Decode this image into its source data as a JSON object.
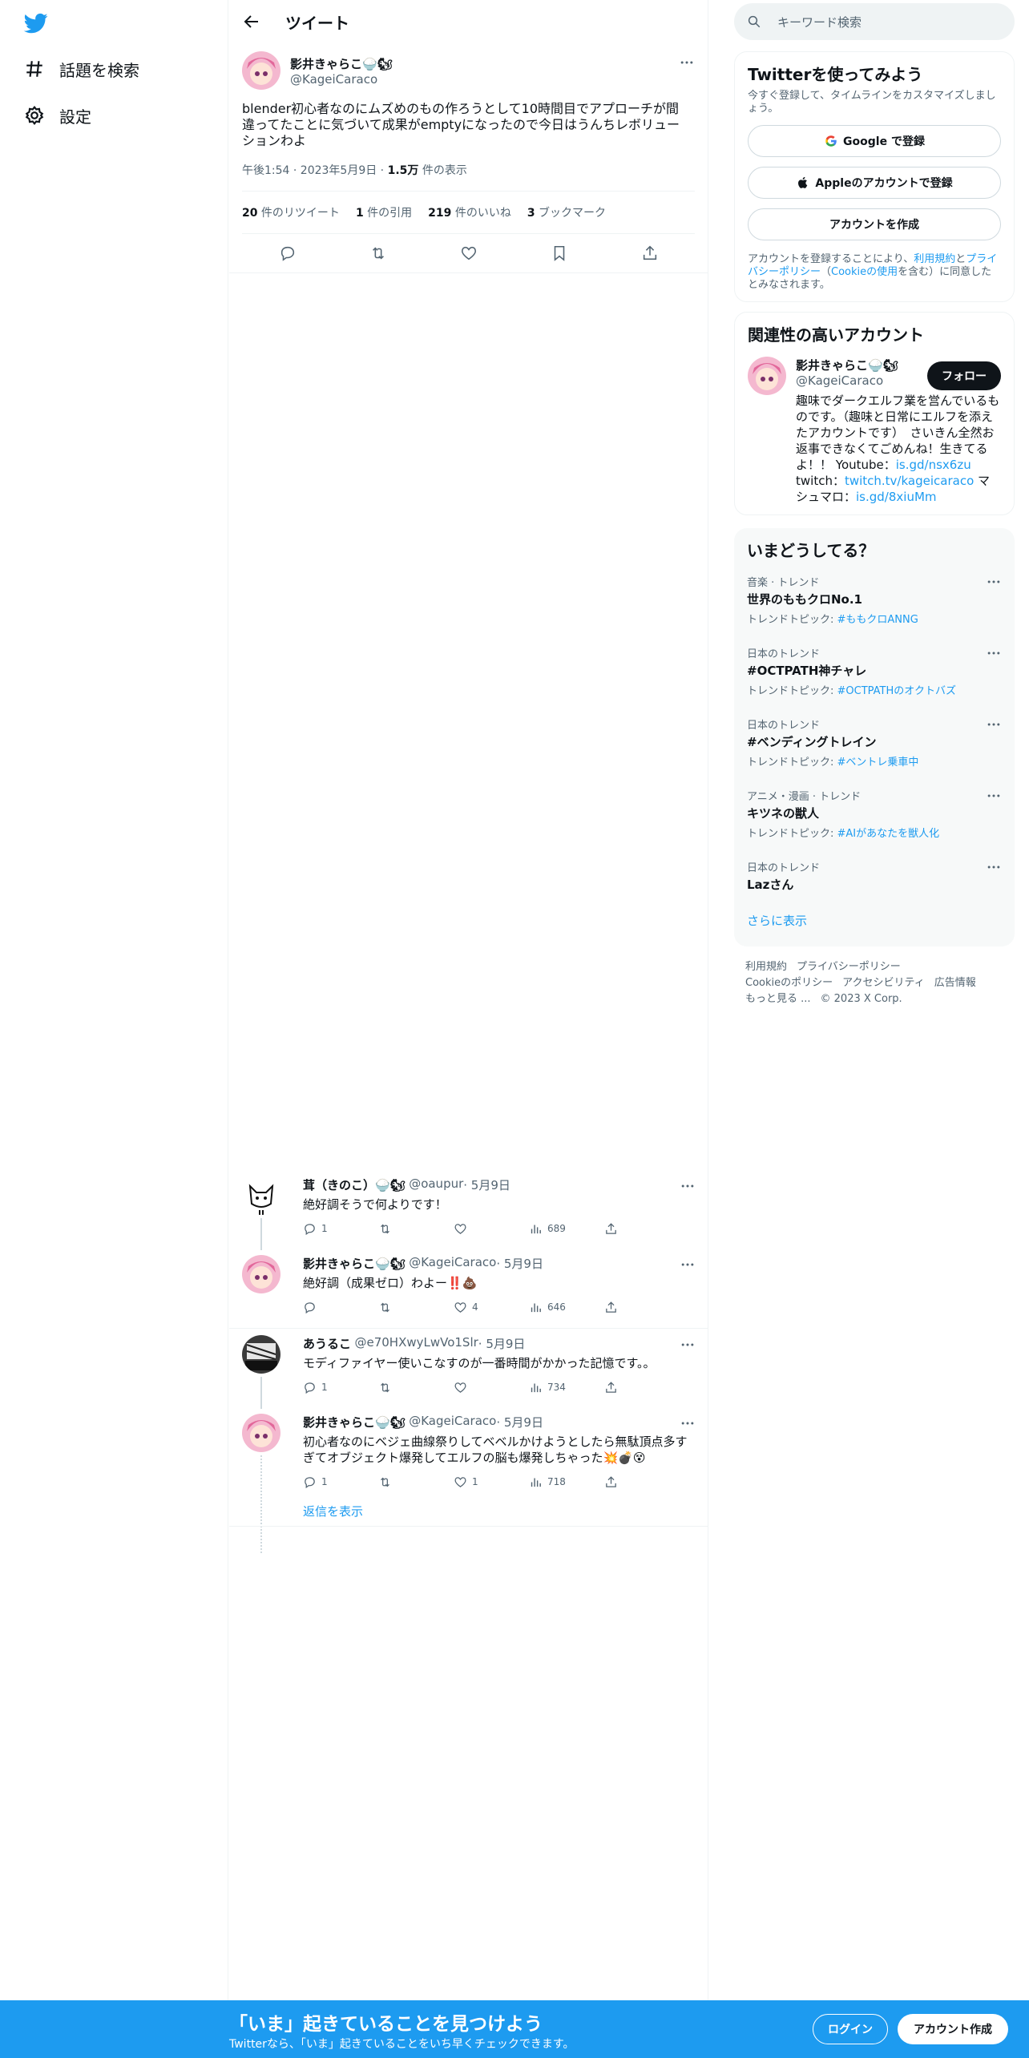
{
  "nav": {
    "explore_label": "話題を検索",
    "settings_label": "設定"
  },
  "header": {
    "title": "ツイート"
  },
  "tweet": {
    "name": "影井きゃらこ🍚🐿",
    "handle": "@KageiCaraco",
    "text": "blender初心者なのにムズめのもの作ろうとして10時間目でアプローチが間違ってたことに気づいて成果がemptyになったので今日はうんちレボリューションわよ",
    "time": "午後1:54 · 2023年5月9日 · ",
    "views_count": "1.5万",
    "views_label": " 件の表示",
    "stats": {
      "retweets_count": "20",
      "retweets_label": " 件のリツイート",
      "quotes_count": "1",
      "quotes_label": " 件の引用",
      "likes_count": "219",
      "likes_label": " 件のいいね",
      "bookmarks_count": "3",
      "bookmarks_label": " ブックマーク"
    }
  },
  "replies": [
    {
      "name": "茸（きのこ）🍚🐿",
      "handle": "@oaupur",
      "date": " · 5月9日",
      "text": "絶好調そうで何よりです！",
      "reply_count": "1",
      "retweet_count": "",
      "like_count": "",
      "view_count": "689"
    },
    {
      "name": "影井きゃらこ🍚🐿",
      "handle": "@KageiCaraco",
      "date": " · 5月9日",
      "text": "絶好調（成果ゼロ）わよー‼️💩",
      "reply_count": "",
      "retweet_count": "",
      "like_count": "4",
      "view_count": "646"
    },
    {
      "name": "あうるこ",
      "handle": "@e70HXwyLwVo1Slr",
      "date": " · 5月9日",
      "text": "モディファイヤー使いこなすのが一番時間がかかった記憶です。。",
      "reply_count": "1",
      "retweet_count": "",
      "like_count": "",
      "view_count": "734"
    },
    {
      "name": "影井きゃらこ🍚🐿",
      "handle": "@KageiCaraco",
      "date": " · 5月9日",
      "text": "初心者なのにベジェ曲線祭りしてベベルかけようとしたら無駄頂点多すぎてオブジェクト爆発してエルフの脳も爆発しちゃった💥💣😵",
      "reply_count": "1",
      "retweet_count": "",
      "like_count": "1",
      "view_count": "718"
    }
  ],
  "show_replies": "返信を表示",
  "right": {
    "search_placeholder": "キーワード検索",
    "signup": {
      "title": "Twitterを使ってみよう",
      "desc": "今すぐ登録して、タイムラインをカスタマイズしましょう。",
      "google": "Google で登録",
      "apple": "Appleのアカウントで登録",
      "create": "アカウントを作成",
      "legal_1": "アカウントを登録することにより、",
      "legal_terms": "利用規約",
      "legal_2": "と",
      "legal_privacy": "プライバシーポリシー",
      "legal_3": "（",
      "legal_cookie": "Cookieの使用",
      "legal_4": "を含む）に同意したとみなされます。"
    },
    "relevant": {
      "title": "関連性の高いアカウント",
      "name": "影井きゃらこ🍚🐿",
      "handle": "@KageiCaraco",
      "follow": "フォロー",
      "bio_1": "趣味でダークエルフ業を営んでいるものです。（趣味と日常にエルフを添えたアカウントです）　さいきん全然お返事できなくてごめんね！生きてるよ！！ Youtube：",
      "bio_link1": "is.gd/nsx6zu",
      "bio_2": "twitch：",
      "bio_link2": "twitch.tv/kageicaraco",
      "bio_3": " マシュマロ：",
      "bio_link3": "is.gd/8xiuMm"
    },
    "trends": {
      "title": "いまどうしてる？",
      "items": [
        {
          "cat": "音楽 · トレンド",
          "title": "世界のももクロNo.1",
          "topic_label": "トレンドトピック: ",
          "topic": "#ももクロANNG"
        },
        {
          "cat": "日本のトレンド",
          "title": "#OCTPATH神チャレ",
          "topic_label": "トレンドトピック: ",
          "topic": "#OCTPATHのオクトバズ"
        },
        {
          "cat": "日本のトレンド",
          "title": "#ベンディングトレイン",
          "topic_label": "トレンドトピック: ",
          "topic": "#ベントレ乗車中"
        },
        {
          "cat": "アニメ・漫画 · トレンド",
          "title": "キツネの獣人",
          "topic_label": "トレンドトピック: ",
          "topic": "#AIがあなたを獣人化"
        },
        {
          "cat": "日本のトレンド",
          "title": "Lazさん",
          "topic_label": "",
          "topic": ""
        }
      ],
      "show_more": "さらに表示"
    },
    "footer": {
      "terms": "利用規約",
      "privacy": "プライバシーポリシー",
      "cookie": "Cookieのポリシー",
      "accessibility": "アクセシビリティ",
      "ads": "広告情報",
      "more": "もっと見る ...",
      "copyright": "© 2023 X Corp."
    }
  },
  "banner": {
    "title": "「いま」起きていることを見つけよう",
    "subtitle": "Twitterなら、「いま」起きていることをいち早くチェックできます。",
    "login": "ログイン",
    "signup": "アカウント作成"
  },
  "colors": {
    "brand": "#1d9bf0",
    "text": "#0f1419",
    "secondary": "#536471"
  }
}
